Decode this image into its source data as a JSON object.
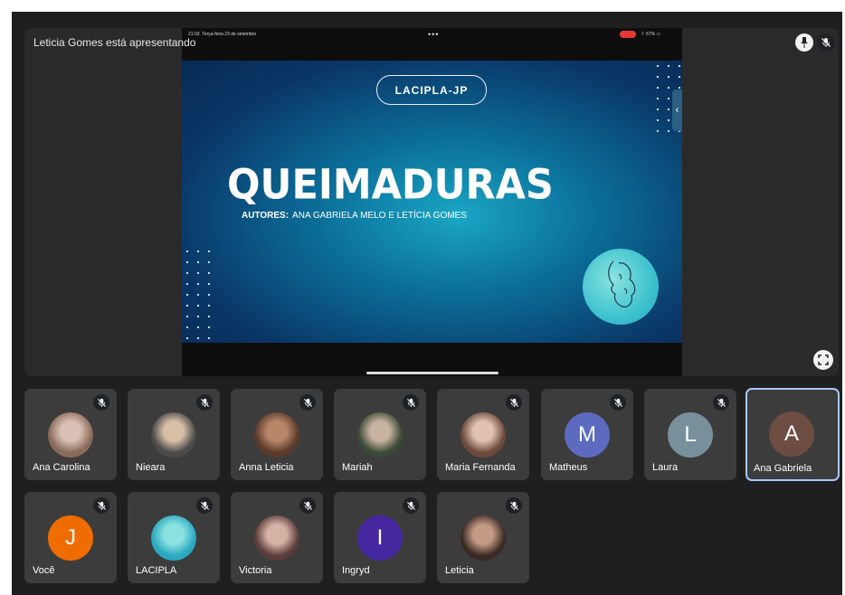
{
  "stage": {
    "presenter_label": "Leticia Gomes está apresentando"
  },
  "device_status": {
    "time": "21:03",
    "date": "Terça-feira 23 de setembro",
    "battery": "67%"
  },
  "slide": {
    "badge": "LACIPLA-JP",
    "title": "QUEIMADURAS",
    "authors_label": "AUTORES:",
    "authors": "ANA GABRIELA MELO E LETÍCIA GOMES"
  },
  "participants": [
    {
      "name": "Ana Carolina",
      "kind": "photo",
      "colors": [
        "#8a6a5a",
        "#d9c2b5"
      ]
    },
    {
      "name": "Nieara",
      "kind": "photo",
      "colors": [
        "#4a4a4a",
        "#d8c0a8"
      ]
    },
    {
      "name": "Anna Leticia",
      "kind": "photo",
      "colors": [
        "#5a3a2a",
        "#b8876a"
      ]
    },
    {
      "name": "Mariah",
      "kind": "photo",
      "colors": [
        "#3b4a36",
        "#c9b3a0"
      ]
    },
    {
      "name": "Maria Fernanda",
      "kind": "photo",
      "colors": [
        "#6b4a3a",
        "#e0c2b0"
      ]
    },
    {
      "name": "Matheus",
      "kind": "initial",
      "initial": "M",
      "color": "#5c6bc0"
    },
    {
      "name": "Laura",
      "kind": "initial",
      "initial": "L",
      "color": "#78909c"
    },
    {
      "name": "Ana Gabriela",
      "kind": "initial",
      "initial": "A",
      "color": "#6d4c41"
    },
    {
      "name": "Você",
      "kind": "initial",
      "initial": "J",
      "color": "#ef6c00"
    },
    {
      "name": "LACIPLA",
      "kind": "photo",
      "colors": [
        "#2aa8c0",
        "#8be3e0"
      ]
    },
    {
      "name": "Victoria",
      "kind": "photo",
      "colors": [
        "#5a3d3a",
        "#d6b2a5"
      ]
    },
    {
      "name": "Ingryd",
      "kind": "initial",
      "initial": "I",
      "color": "#4527a0"
    },
    {
      "name": "Leticia",
      "kind": "photo",
      "colors": [
        "#3a2a24",
        "#c49a84"
      ]
    }
  ],
  "active_participant": "Ana Gabriela",
  "icons": {
    "mute": "mic-off-icon",
    "pin": "pin-icon",
    "fullscreen": "fullscreen-icon"
  }
}
